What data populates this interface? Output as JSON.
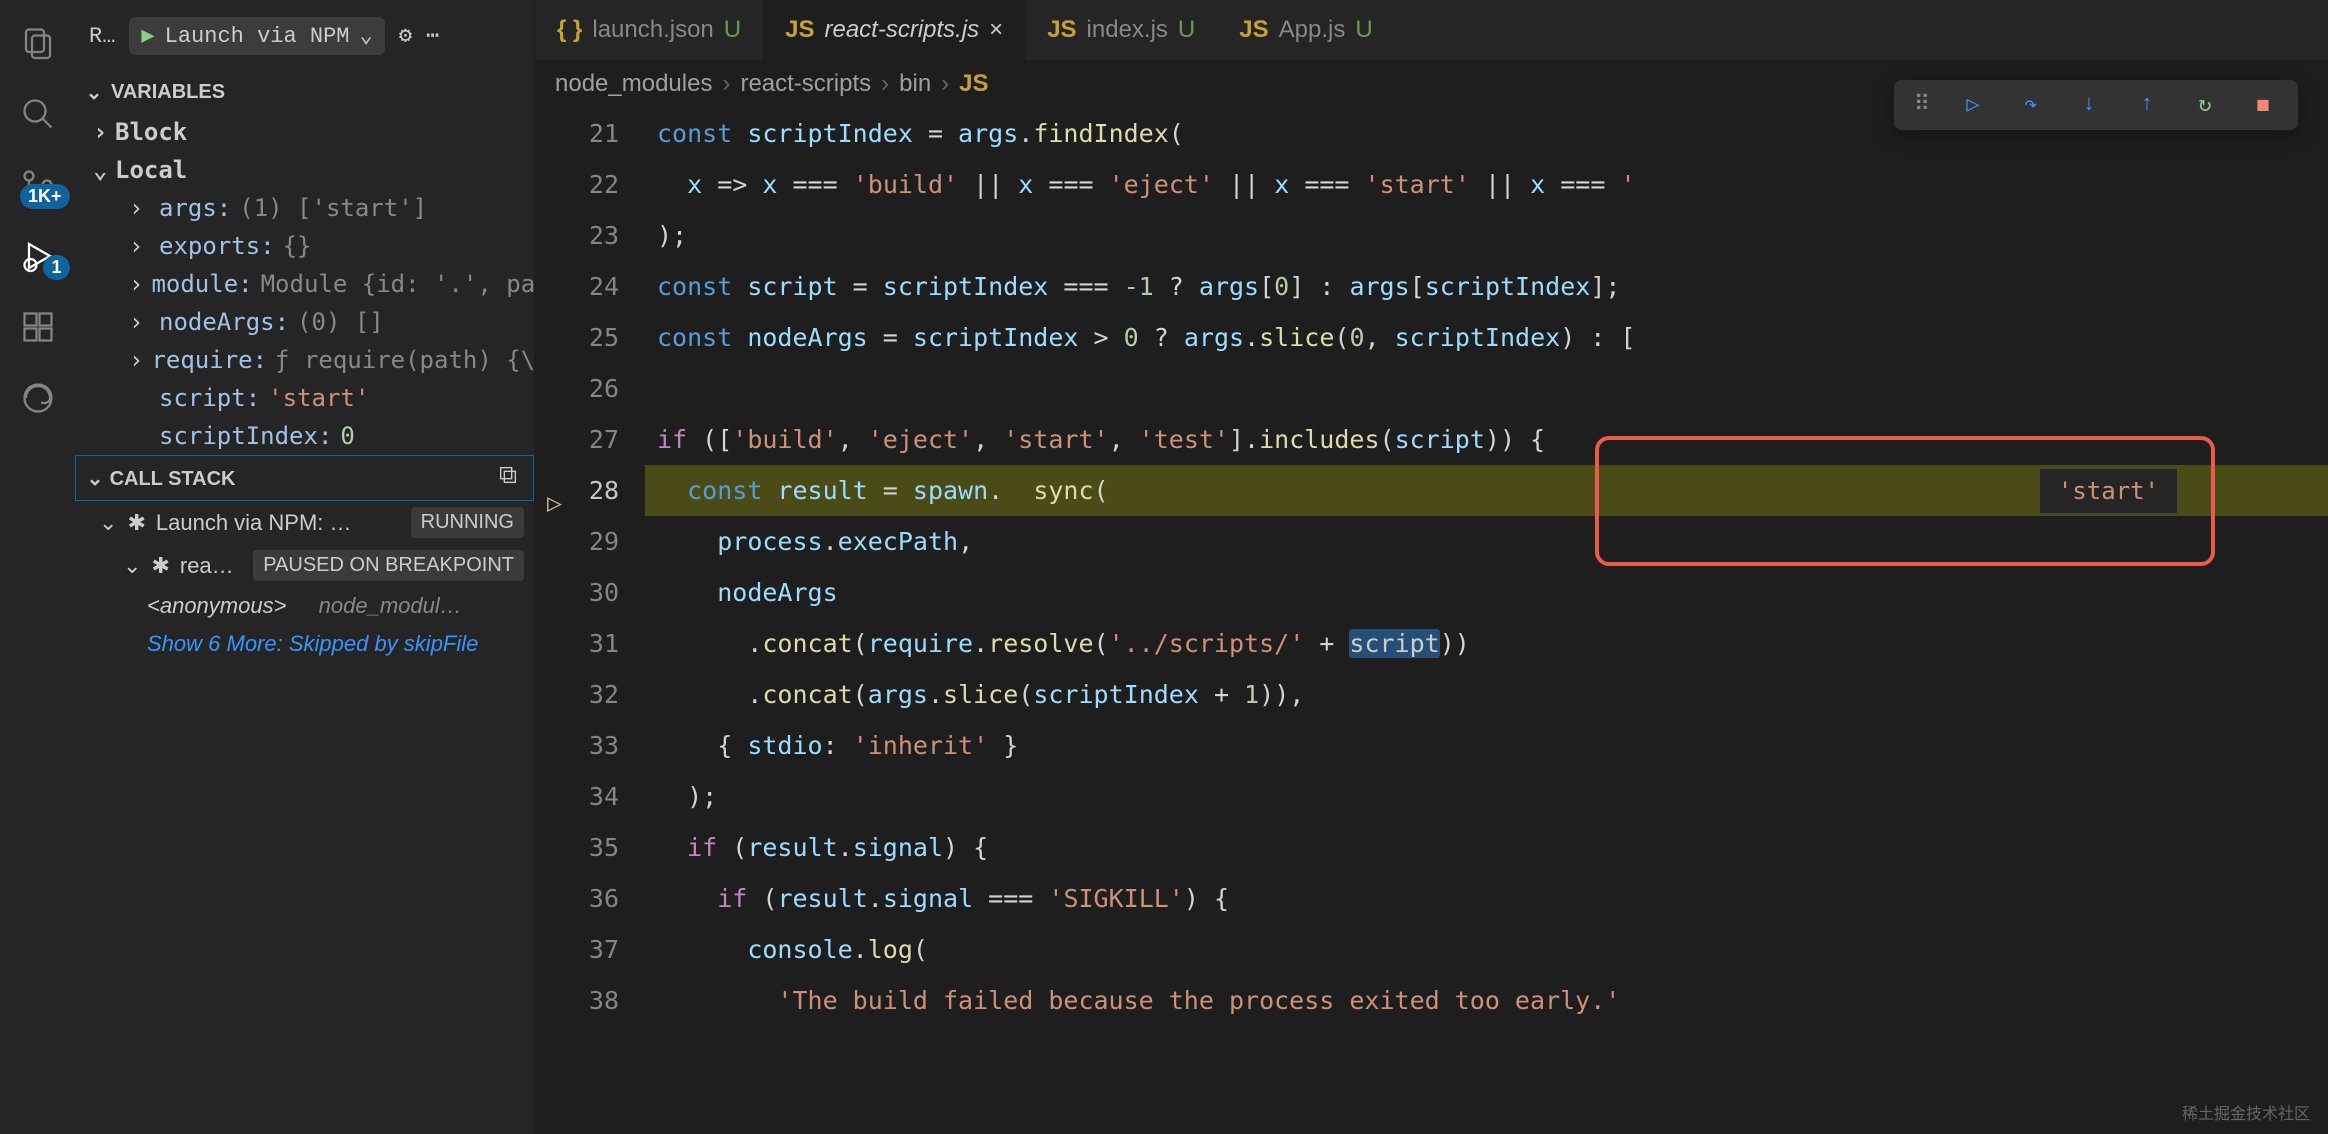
{
  "activity": {
    "badges": {
      "scm": "1K+",
      "debug": "1"
    }
  },
  "debugbar": {
    "run_label": "R…",
    "config": "Launch via NPM",
    "gear": "⚙",
    "more": "⋯"
  },
  "variables": {
    "title": "VARIABLES",
    "scopes": [
      {
        "name": "Block",
        "expanded": false
      },
      {
        "name": "Local",
        "expanded": true
      }
    ],
    "locals": [
      {
        "k": "args:",
        "v": "(1) ['start']",
        "exp": true
      },
      {
        "k": "exports:",
        "v": "{}",
        "exp": true
      },
      {
        "k": "module:",
        "v": "Module {id: '.', path…",
        "exp": true
      },
      {
        "k": "nodeArgs:",
        "v": "(0) []",
        "exp": true
      },
      {
        "k": "require:",
        "v": "ƒ require(path) {\\n …",
        "exp": true
      },
      {
        "k": "script:",
        "v": "'start'",
        "exp": false,
        "str": true
      },
      {
        "k": "scriptIndex:",
        "v": "0",
        "exp": false,
        "num": true
      }
    ]
  },
  "callstack": {
    "title": "CALL STACK",
    "session": "Launch via NPM: …",
    "session_tag": "RUNNING",
    "thread": "rea…",
    "thread_tag": "PAUSED ON BREAKPOINT",
    "frame_name": "<anonymous>",
    "frame_loc": "node_modul…",
    "more": "Show 6 More: Skipped by skipFile"
  },
  "tabs": [
    {
      "icon": "{ }",
      "name": "launch.json",
      "git": "U",
      "type": "json"
    },
    {
      "icon": "JS",
      "name": "react-scripts.js",
      "close": "×",
      "active": true,
      "italic": true,
      "type": "js"
    },
    {
      "icon": "JS",
      "name": "index.js",
      "git": "U",
      "type": "js"
    },
    {
      "icon": "JS",
      "name": "App.js",
      "git": "U",
      "type": "js"
    }
  ],
  "breadcrumbs": [
    "node_modules",
    "react-scripts",
    "bin"
  ],
  "breadcrumb_file_icon": "JS",
  "hover_value": "'start'",
  "code": {
    "start": 21,
    "lines": [
      [
        [
          "tok-const",
          "const "
        ],
        [
          "tok-var",
          "scriptIndex"
        ],
        [
          "tok-op",
          " = "
        ],
        [
          "tok-var",
          "args"
        ],
        [
          "tok-pn",
          "."
        ],
        [
          "tok-fn",
          "findIndex"
        ],
        [
          "tok-pn",
          "("
        ]
      ],
      [
        [
          "tok-pn",
          "  "
        ],
        [
          "tok-var",
          "x"
        ],
        [
          "tok-op",
          " => "
        ],
        [
          "tok-var",
          "x"
        ],
        [
          "tok-op",
          " === "
        ],
        [
          "tok-str",
          "'build'"
        ],
        [
          "tok-op",
          " || "
        ],
        [
          "tok-var",
          "x"
        ],
        [
          "tok-op",
          " === "
        ],
        [
          "tok-str",
          "'eject'"
        ],
        [
          "tok-op",
          " || "
        ],
        [
          "tok-var",
          "x"
        ],
        [
          "tok-op",
          " === "
        ],
        [
          "tok-str",
          "'start'"
        ],
        [
          "tok-op",
          " || "
        ],
        [
          "tok-var",
          "x"
        ],
        [
          "tok-op",
          " === "
        ],
        [
          "tok-str",
          "'"
        ]
      ],
      [
        [
          "tok-pn",
          ");"
        ]
      ],
      [
        [
          "tok-const",
          "const "
        ],
        [
          "tok-var",
          "script"
        ],
        [
          "tok-op",
          " = "
        ],
        [
          "tok-var",
          "scriptIndex"
        ],
        [
          "tok-op",
          " === "
        ],
        [
          "tok-num",
          "-1"
        ],
        [
          "tok-op",
          " ? "
        ],
        [
          "tok-var",
          "args"
        ],
        [
          "tok-pn",
          "["
        ],
        [
          "tok-num",
          "0"
        ],
        [
          "tok-pn",
          "]"
        ],
        [
          "tok-op",
          " : "
        ],
        [
          "tok-var",
          "args"
        ],
        [
          "tok-pn",
          "["
        ],
        [
          "tok-var",
          "scriptIndex"
        ],
        [
          "tok-pn",
          "];"
        ]
      ],
      [
        [
          "tok-const",
          "const "
        ],
        [
          "tok-var",
          "nodeArgs"
        ],
        [
          "tok-op",
          " = "
        ],
        [
          "tok-var",
          "scriptIndex"
        ],
        [
          "tok-op",
          " > "
        ],
        [
          "tok-num",
          "0"
        ],
        [
          "tok-op",
          " ? "
        ],
        [
          "tok-var",
          "args"
        ],
        [
          "tok-pn",
          "."
        ],
        [
          "tok-fn",
          "slice"
        ],
        [
          "tok-pn",
          "("
        ],
        [
          "tok-num",
          "0"
        ],
        [
          "tok-pn",
          ", "
        ],
        [
          "tok-var",
          "scriptIndex"
        ],
        [
          "tok-pn",
          ") : ["
        ]
      ],
      [
        [
          "tok-pn",
          ""
        ]
      ],
      [
        [
          "tok-kw",
          "if "
        ],
        [
          "tok-pn",
          "(["
        ],
        [
          "tok-str",
          "'build'"
        ],
        [
          "tok-pn",
          ", "
        ],
        [
          "tok-str",
          "'eject'"
        ],
        [
          "tok-pn",
          ", "
        ],
        [
          "tok-str",
          "'start'"
        ],
        [
          "tok-pn",
          ", "
        ],
        [
          "tok-str",
          "'test'"
        ],
        [
          "tok-pn",
          "]."
        ],
        [
          "tok-fn",
          "includes"
        ],
        [
          "tok-pn",
          "("
        ],
        [
          "tok-var",
          "script"
        ],
        [
          "tok-pn",
          ")) {"
        ]
      ],
      [
        [
          "tok-pn",
          "  "
        ],
        [
          "tok-const",
          "const "
        ],
        [
          "tok-var",
          "result"
        ],
        [
          "tok-op",
          " = "
        ],
        [
          "tok-var",
          "spawn"
        ],
        [
          "tok-pn",
          ".  "
        ],
        [
          "tok-fn",
          "sync"
        ],
        [
          "tok-pn",
          "("
        ]
      ],
      [
        [
          "tok-pn",
          "    "
        ],
        [
          "tok-var",
          "process"
        ],
        [
          "tok-pn",
          "."
        ],
        [
          "tok-prop",
          "execPath"
        ],
        [
          "tok-pn",
          ","
        ]
      ],
      [
        [
          "tok-pn",
          "    "
        ],
        [
          "tok-var",
          "nodeArgs"
        ]
      ],
      [
        [
          "tok-pn",
          "      ."
        ],
        [
          "tok-fn",
          "concat"
        ],
        [
          "tok-pn",
          "("
        ],
        [
          "tok-var",
          "require"
        ],
        [
          "tok-pn",
          "."
        ],
        [
          "tok-fn",
          "resolve"
        ],
        [
          "tok-pn",
          "("
        ],
        [
          "tok-str",
          "'../scripts/'"
        ],
        [
          "tok-op",
          " + "
        ],
        [
          "hl-script",
          "script"
        ],
        [
          "tok-pn",
          "))"
        ]
      ],
      [
        [
          "tok-pn",
          "      ."
        ],
        [
          "tok-fn",
          "concat"
        ],
        [
          "tok-pn",
          "("
        ],
        [
          "tok-var",
          "args"
        ],
        [
          "tok-pn",
          "."
        ],
        [
          "tok-fn",
          "slice"
        ],
        [
          "tok-pn",
          "("
        ],
        [
          "tok-var",
          "scriptIndex"
        ],
        [
          "tok-op",
          " + "
        ],
        [
          "tok-num",
          "1"
        ],
        [
          "tok-pn",
          ")),"
        ]
      ],
      [
        [
          "tok-pn",
          "    { "
        ],
        [
          "tok-prop",
          "stdio"
        ],
        [
          "tok-pn",
          ": "
        ],
        [
          "tok-str",
          "'inherit'"
        ],
        [
          "tok-pn",
          " }"
        ]
      ],
      [
        [
          "tok-pn",
          "  );"
        ]
      ],
      [
        [
          "tok-pn",
          "  "
        ],
        [
          "tok-kw",
          "if "
        ],
        [
          "tok-pn",
          "("
        ],
        [
          "tok-var",
          "result"
        ],
        [
          "tok-pn",
          "."
        ],
        [
          "tok-prop",
          "signal"
        ],
        [
          "tok-pn",
          ") {"
        ]
      ],
      [
        [
          "tok-pn",
          "    "
        ],
        [
          "tok-kw",
          "if "
        ],
        [
          "tok-pn",
          "("
        ],
        [
          "tok-var",
          "result"
        ],
        [
          "tok-pn",
          "."
        ],
        [
          "tok-prop",
          "signal"
        ],
        [
          "tok-op",
          " === "
        ],
        [
          "tok-str",
          "'SIGKILL'"
        ],
        [
          "tok-pn",
          ") {"
        ]
      ],
      [
        [
          "tok-pn",
          "      "
        ],
        [
          "tok-var",
          "console"
        ],
        [
          "tok-pn",
          "."
        ],
        [
          "tok-fn",
          "log"
        ],
        [
          "tok-pn",
          "("
        ]
      ],
      [
        [
          "tok-pn",
          "        "
        ],
        [
          "tok-str",
          "'The build failed because the process exited too early.' "
        ]
      ]
    ],
    "current_index": 7
  },
  "watermark": "稀土掘金技术社区"
}
